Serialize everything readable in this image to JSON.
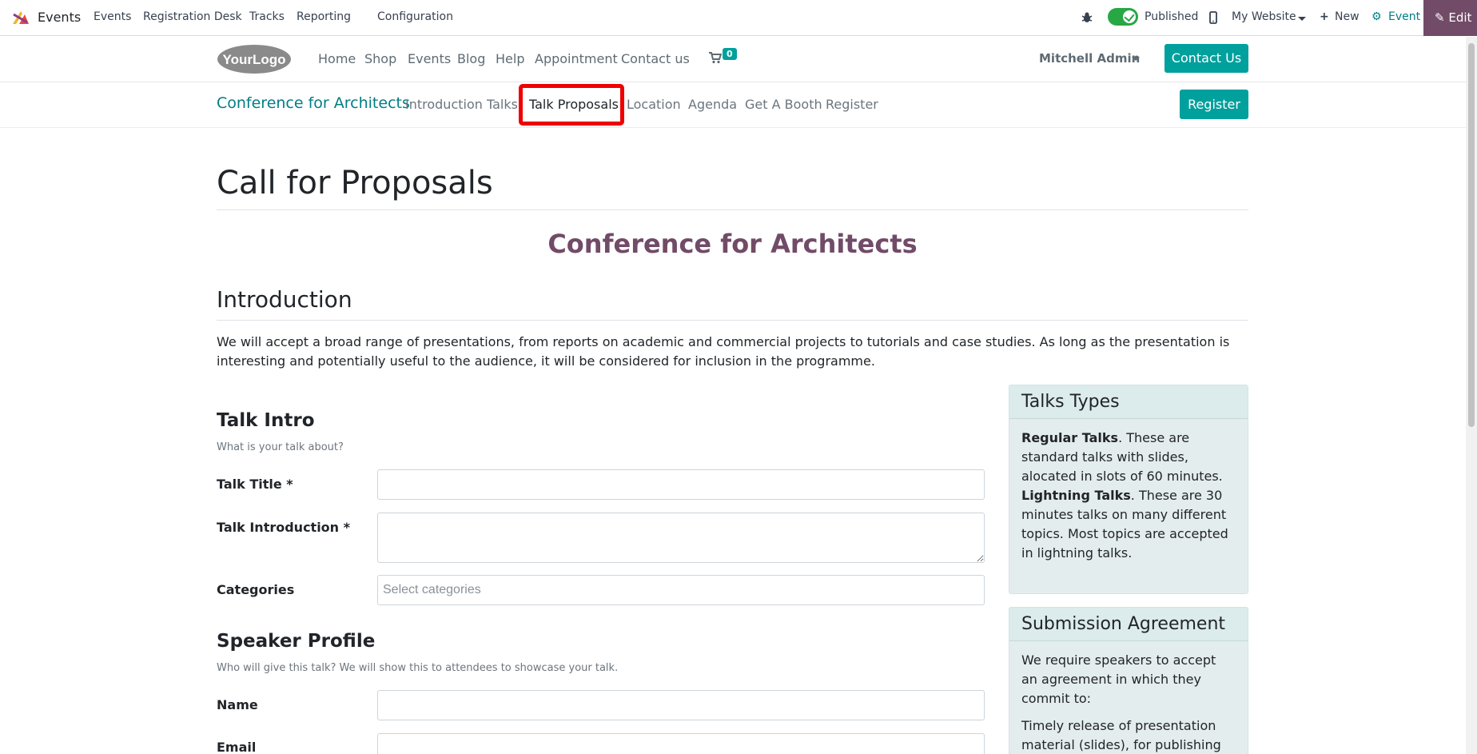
{
  "adminbar": {
    "app_name": "Events",
    "menu": [
      "Events",
      "Registration Desk",
      "Tracks",
      "Reporting",
      "Configuration"
    ],
    "published_label": "Published",
    "website_label": "My Website",
    "new_label": "New",
    "event_label": "Event",
    "edit_label": "Edit"
  },
  "header": {
    "logo_text": "YourLogo",
    "nav": [
      "Home",
      "Shop",
      "Events",
      "Blog",
      "Help",
      "Appointment",
      "Contact us"
    ],
    "cart_count": "0",
    "user": "Mitchell Admin",
    "contact_button": "Contact Us"
  },
  "event_nav": {
    "title": "Conference for Architects",
    "links": [
      "Introduction",
      "Talks",
      "Talk Proposals",
      "Location",
      "Agenda",
      "Get A Booth",
      "Register"
    ],
    "active": "Talk Proposals",
    "register_button": "Register"
  },
  "main": {
    "page_title": "Call for Proposals",
    "event_name": "Conference for Architects",
    "intro_heading": "Introduction",
    "intro_text": "We will accept a broad range of presentations, from reports on academic and commercial projects to tutorials and case studies. As long as the presentation is interesting and potentially useful to the audience, it will be considered for inclusion in the programme.",
    "talk_intro": {
      "heading": "Talk Intro",
      "subtitle": "What is your talk about?",
      "title_label": "Talk Title *",
      "intro_label": "Talk Introduction *",
      "categories_label": "Categories",
      "categories_placeholder": "Select categories"
    },
    "speaker": {
      "heading": "Speaker Profile",
      "subtitle": "Who will give this talk? We will show this to attendees to showcase your talk.",
      "name_label": "Name",
      "email_label": "Email"
    }
  },
  "sidebar": {
    "types": {
      "heading": "Talks Types",
      "regular_bold": "Regular Talks",
      "regular_text": ". These are standard talks with slides, alocated in slots of 60 minutes.",
      "lightning_bold": "Lightning Talks",
      "lightning_text": ". These are 30 minutes talks on many different topics. Most topics are accepted in lightning talks."
    },
    "agreement": {
      "heading": "Submission Agreement",
      "p1": "We require speakers to accept an agreement in which they commit to:",
      "p2": "Timely release of presentation material (slides), for publishing on our website."
    }
  },
  "colors": {
    "primary": "#00a09d",
    "odoo_purple": "#714b67",
    "event_title": "#017e84",
    "highlight": "#ee0000"
  }
}
